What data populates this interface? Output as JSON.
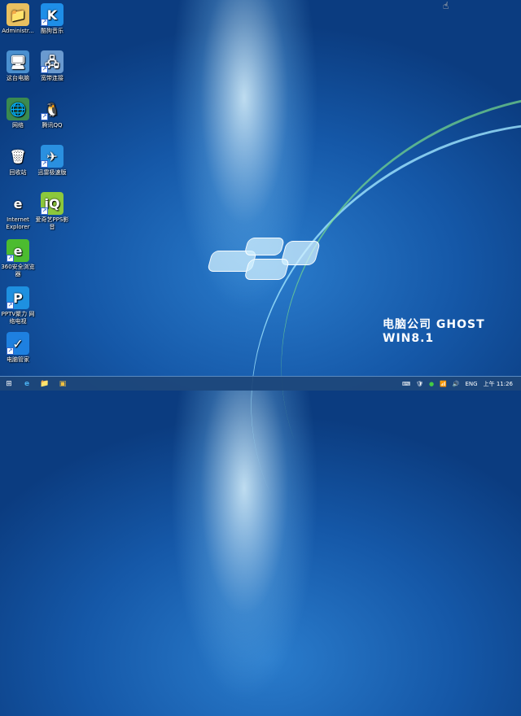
{
  "desktop": {
    "icons": [
      {
        "label": "Administr...",
        "icon": "user-folder-icon",
        "bg": "#e8c060",
        "glyph": "📁",
        "shortcut": false
      },
      {
        "label": "酷狗音乐",
        "icon": "kugou-icon",
        "bg": "#1e8ee8",
        "glyph": "K",
        "shortcut": true
      },
      {
        "label": "这台电脑",
        "icon": "computer-icon",
        "bg": "#4a90d0",
        "glyph": "🖥",
        "shortcut": false
      },
      {
        "label": "宽带连接",
        "icon": "broadband-icon",
        "bg": "#6a9ad0",
        "glyph": "🖧",
        "shortcut": true
      },
      {
        "label": "网络",
        "icon": "network-icon",
        "bg": "#3a8a50",
        "glyph": "🌐",
        "shortcut": false
      },
      {
        "label": "腾讯QQ",
        "icon": "qq-icon",
        "bg": "transparent",
        "glyph": "🐧",
        "shortcut": true
      },
      {
        "label": "回收站",
        "icon": "recycle-bin-icon",
        "bg": "transparent",
        "glyph": "🗑",
        "shortcut": false
      },
      {
        "label": "迅雷极速版",
        "icon": "xunlei-icon",
        "bg": "#2a90e0",
        "glyph": "✈",
        "shortcut": true
      },
      {
        "label": "Internet Explorer",
        "icon": "ie-icon",
        "bg": "transparent",
        "glyph": "e",
        "shortcut": false
      },
      {
        "label": "爱奇艺PPS影音",
        "icon": "iqiyi-icon",
        "bg": "#8cc83c",
        "glyph": "iQ",
        "shortcut": true
      },
      {
        "label": "360安全浏览器",
        "icon": "360-browser-icon",
        "bg": "#4cbc30",
        "glyph": "e",
        "shortcut": true
      },
      {
        "label": "PPTV聚力 网络电视",
        "icon": "pptv-icon",
        "bg": "#1e90e0",
        "glyph": "P",
        "shortcut": true
      },
      {
        "label": "电脑管家",
        "icon": "pc-manager-icon",
        "bg": "#1e80e0",
        "glyph": "✓",
        "shortcut": true
      }
    ]
  },
  "brand": "电脑公司  GHOST  WIN8.1",
  "taskbar": {
    "start": "⊞",
    "ie": "e",
    "explorer": "📁",
    "media": "▣",
    "tray": {
      "keyboard": "⌨",
      "security": "🛡",
      "guard": "●",
      "network": "📶",
      "volume": "🔊",
      "lang": "ENG",
      "time": "上午 11:26"
    }
  }
}
